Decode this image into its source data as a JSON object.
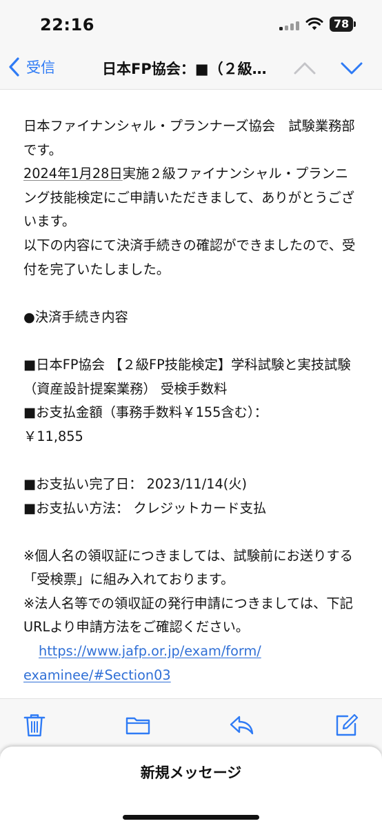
{
  "status_bar": {
    "time": "22:16",
    "battery": "78"
  },
  "nav": {
    "back_label": "受信",
    "title": "日本FP協会：■（２級…"
  },
  "mail": {
    "para1": "日本ファイナンシャル・プランナーズ協会　試験業務部です。",
    "para2_date": "2024年1月28日",
    "para2_rest": "実施２級ファイナンシャル・プランニング技能検定にご申請いただきまして、ありがとうございます。",
    "para3": "以下の内容にて決済手続きの確認ができましたので、受付を完了いたしました。",
    "section_heading": "●決済手続き内容",
    "item_exam": "■日本FP協会 【２級FP技能検定】学科試験と実技試験（資産設計提案業務） 受検手数料",
    "item_amount_label": "■お支払金額（事務手数料￥155含む）：",
    "item_amount_value": "￥11,855",
    "item_date": "■お支払い完了日： 2023/11/14(火)",
    "item_method": "■お支払い方法： クレジットカード支払",
    "note1": "※個人名の領収証につきましては、試験前にお送りする「受検票」に組み入れております。",
    "note2": "※法人名等での領収証の発行申請につきましては、下記URLより申請方法をご確認ください。",
    "link_line1": "https://www.jafp.or.jp/exam/form/",
    "link_line2": "examinee/#Section03"
  },
  "toolbar": {
    "icons": [
      "trash-icon",
      "folder-icon",
      "reply-icon",
      "compose-icon"
    ]
  },
  "sheet": {
    "title": "新規メッセージ"
  },
  "colors": {
    "accent": "#2f7bf5",
    "link": "#2f6fd6"
  }
}
